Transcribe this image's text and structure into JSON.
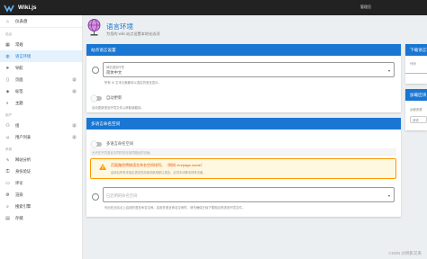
{
  "app": {
    "brand": "Wiki.js",
    "user_label": "管理员"
  },
  "sidebar": {
    "dashboard": "仪表盘",
    "sections": {
      "site": "站点",
      "users": "用户",
      "system": "系统"
    },
    "site_items": [
      {
        "label": "常规",
        "icon": "grid-icon"
      },
      {
        "label": "语言环境",
        "icon": "globe-icon",
        "active": true
      },
      {
        "label": "导航",
        "icon": "navigation-icon"
      },
      {
        "label": "页面",
        "icon": "page-icon",
        "badge": "2"
      },
      {
        "label": "标签",
        "icon": "tag-icon",
        "badge": "0"
      },
      {
        "label": "主题",
        "icon": "palette-icon"
      }
    ],
    "user_items": [
      {
        "label": "组",
        "icon": "group-icon",
        "badge": "2"
      },
      {
        "label": "用户列表",
        "icon": "users-icon",
        "badge": "2"
      }
    ],
    "system_items": [
      {
        "label": "网站分析",
        "icon": "analytics-icon"
      },
      {
        "label": "身份验证",
        "icon": "auth-icon"
      },
      {
        "label": "评论",
        "icon": "comment-icon"
      },
      {
        "label": "渲染",
        "icon": "render-icon"
      },
      {
        "label": "搜索引擎",
        "icon": "search-engine-icon"
      },
      {
        "label": "存储",
        "icon": "storage-icon"
      }
    ]
  },
  "header": {
    "title": "语言环境",
    "subtitle": "为您的 wiki 站点设置本地化选项"
  },
  "locale_card": {
    "heading": "站点语言设置",
    "select_value": "简体中文",
    "select_label": "网站语言环境",
    "select_hint": "所有 UI 文本元素都将以选定的语言显示。",
    "auto_update_label": "自动更新",
    "auto_update_hint": "自动更新语言环境文件以获取新翻译。"
  },
  "namespace_card": {
    "heading": "多语言命名空间",
    "toggle_label": "多语言命名空间",
    "toggle_hint": "允许在不同语言中同时存在相同路径的页面。",
    "warning_title": "页面路径将按语言命名空间排列。（例如 /en/page-name）",
    "warning_text": "启用后所有未指定语言的页面将使用默认语言。必须手动移动现有页面。",
    "namespaces_placeholder": "已启用的命名空间",
    "namespaces_hint": "列出在此站点上启用的语言命名空间。启用多语言命名空间时，请先确保已经下载相应的语言环境文件。"
  },
  "right_panel": {
    "download_heading": "下载语言环境",
    "download_label": "代码",
    "import_heading": "加载区块",
    "import_label": "远程资源",
    "import_hint": "请求"
  },
  "watermark": "CSDN @倒影又来",
  "colors": {
    "accent": "#1976d2",
    "warning": "#ff9800",
    "topbar": "#222222"
  }
}
